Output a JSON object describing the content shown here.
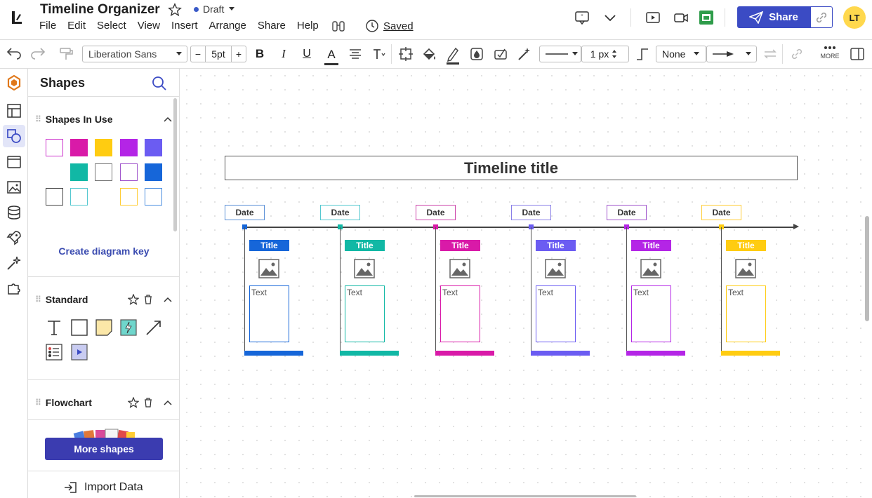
{
  "header": {
    "doc_title": "Timeline Organizer",
    "status": "Draft",
    "saved_label": "Saved",
    "share_label": "Share",
    "avatar_initials": "LT",
    "menu": [
      "File",
      "Edit",
      "Select",
      "View",
      "Insert",
      "Arrange",
      "Share",
      "Help"
    ],
    "icons": [
      "comment-icon",
      "chevron-down-icon",
      "present-icon",
      "video-icon",
      "sheets-icon"
    ]
  },
  "toolbar": {
    "font": "Liberation Sans",
    "font_size": "5pt",
    "minus": "−",
    "plus": "+",
    "bold": "B",
    "italic": "I",
    "underline": "U",
    "text_color": "A",
    "line_width": "1 px",
    "line_end": "None",
    "more": "MORE"
  },
  "panel": {
    "title": "Shapes",
    "shapes_in_use": "Shapes In Use",
    "create_key": "Create diagram key",
    "standard": "Standard",
    "flowchart": "Flowchart",
    "more_shapes": "More shapes",
    "import_data": "Import Data"
  },
  "swatches": [
    {
      "fill": "#ffffff",
      "stroke": "#cc33cc"
    },
    {
      "fill": "#d91aa8",
      "stroke": "#d91aa8"
    },
    {
      "fill": "#ffcc11",
      "stroke": "#ffcc11"
    },
    {
      "fill": "#b425e6",
      "stroke": "#b425e6"
    },
    {
      "fill": "#6b5cf2",
      "stroke": "#6b5cf2"
    },
    {
      "fill": "#11b8a5",
      "stroke": "#11b8a5"
    },
    {
      "fill": "#ffffff",
      "stroke": "#777777"
    },
    {
      "fill": "#ffffff",
      "stroke": "#a055cc"
    },
    {
      "fill": "#1666d9",
      "stroke": "#1666d9"
    },
    {
      "fill": "#ffffff",
      "stroke": "#444444"
    },
    {
      "fill": "#ffffff",
      "stroke": "#55c8d0"
    },
    {
      "fill": "#ffffff",
      "stroke": "#ffcc33"
    },
    {
      "fill": "#ffffff",
      "stroke": "#4a8ee0"
    }
  ],
  "timeline": {
    "title": "Timeline title",
    "entries": [
      {
        "date": "Date",
        "title": "Title",
        "text": "Text",
        "color": "#1666d9",
        "date_border": "#5a8fd6"
      },
      {
        "date": "Date",
        "title": "Title",
        "text": "Text",
        "color": "#11b8a5",
        "date_border": "#55c8d0"
      },
      {
        "date": "Date",
        "title": "Title",
        "text": "Text",
        "color": "#d91aa8",
        "date_border": "#cc44aa"
      },
      {
        "date": "Date",
        "title": "Title",
        "text": "Text",
        "color": "#6b5cf2",
        "date_border": "#8a80e8"
      },
      {
        "date": "Date",
        "title": "Title",
        "text": "Text",
        "color": "#b425e6",
        "date_border": "#a055cc"
      },
      {
        "date": "Date",
        "title": "Title",
        "text": "Text",
        "color": "#ffcc11",
        "date_border": "#ffcc33"
      }
    ]
  }
}
